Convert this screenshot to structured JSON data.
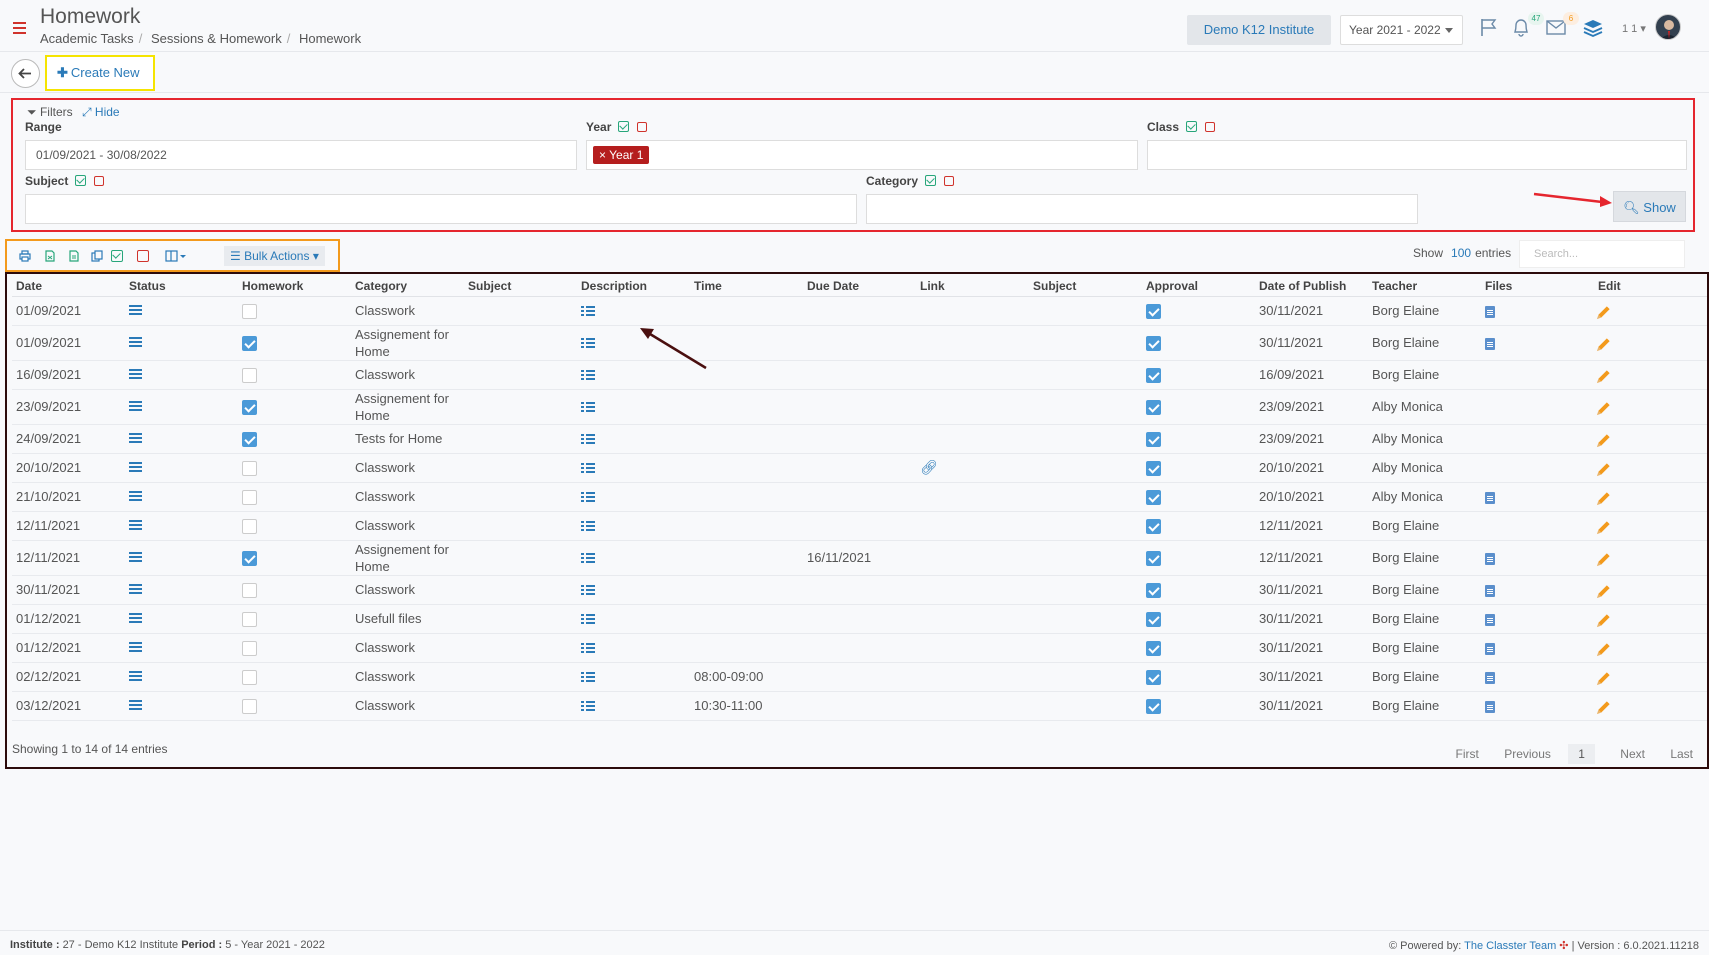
{
  "header": {
    "title": "Homework",
    "breadcrumb": [
      "Academic Tasks",
      "Sessions & Homework",
      "Homework"
    ],
    "institute_button": "Demo K12 Institute",
    "year_select": "Year 2021 - 2022",
    "notifications_count": "47",
    "messages_count": "6",
    "user_count": "1 1",
    "icons": [
      "menu-icon",
      "flag-icon",
      "bell-icon",
      "envelope-icon",
      "layers-icon",
      "avatar"
    ]
  },
  "actions": {
    "create_new": "Create New"
  },
  "filters": {
    "title": "Filters",
    "hide": "Hide",
    "range_label": "Range",
    "range_value": "01/09/2021 - 30/08/2022",
    "year_label": "Year",
    "year_tag": "Year 1",
    "class_label": "Class",
    "subject_label": "Subject",
    "category_label": "Category",
    "show_button": "Show"
  },
  "toolbar": {
    "bulk_actions": "Bulk Actions",
    "show_label": "Show",
    "entries_count": "100",
    "entries_label": "entries",
    "search_placeholder": "Search..."
  },
  "table": {
    "columns": [
      "Date",
      "Status",
      "Homework",
      "Category",
      "Subject",
      "Description",
      "Time",
      "Due Date",
      "Link",
      "Subject",
      "Approval",
      "Date of Publish",
      "Teacher",
      "Files",
      "Edit"
    ],
    "rows": [
      {
        "date": "01/09/2021",
        "homework": false,
        "category": "Classwork",
        "time": "",
        "due": "",
        "link": false,
        "publish": "30/11/2021",
        "teacher": "Borg Elaine",
        "file": true
      },
      {
        "date": "01/09/2021",
        "homework": true,
        "category": "Assignement for Home",
        "time": "",
        "due": "",
        "link": false,
        "publish": "30/11/2021",
        "teacher": "Borg Elaine",
        "file": true
      },
      {
        "date": "16/09/2021",
        "homework": false,
        "category": "Classwork",
        "time": "",
        "due": "",
        "link": false,
        "publish": "16/09/2021",
        "teacher": "Borg Elaine",
        "file": false
      },
      {
        "date": "23/09/2021",
        "homework": true,
        "category": "Assignement for Home",
        "time": "",
        "due": "",
        "link": false,
        "publish": "23/09/2021",
        "teacher": "Alby Monica",
        "file": false
      },
      {
        "date": "24/09/2021",
        "homework": true,
        "category": "Tests for Home",
        "time": "",
        "due": "",
        "link": false,
        "publish": "23/09/2021",
        "teacher": "Alby Monica",
        "file": false
      },
      {
        "date": "20/10/2021",
        "homework": false,
        "category": "Classwork",
        "time": "",
        "due": "",
        "link": true,
        "publish": "20/10/2021",
        "teacher": "Alby Monica",
        "file": false
      },
      {
        "date": "21/10/2021",
        "homework": false,
        "category": "Classwork",
        "time": "",
        "due": "",
        "link": false,
        "publish": "20/10/2021",
        "teacher": "Alby Monica",
        "file": true
      },
      {
        "date": "12/11/2021",
        "homework": false,
        "category": "Classwork",
        "time": "",
        "due": "",
        "link": false,
        "publish": "12/11/2021",
        "teacher": "Borg Elaine",
        "file": false
      },
      {
        "date": "12/11/2021",
        "homework": true,
        "category": "Assignement for Home",
        "time": "",
        "due": "16/11/2021",
        "link": false,
        "publish": "12/11/2021",
        "teacher": "Borg Elaine",
        "file": true
      },
      {
        "date": "30/11/2021",
        "homework": false,
        "category": "Classwork",
        "time": "",
        "due": "",
        "link": false,
        "publish": "30/11/2021",
        "teacher": "Borg Elaine",
        "file": true
      },
      {
        "date": "01/12/2021",
        "homework": false,
        "category": "Usefull files",
        "time": "",
        "due": "",
        "link": false,
        "publish": "30/11/2021",
        "teacher": "Borg Elaine",
        "file": true
      },
      {
        "date": "01/12/2021",
        "homework": false,
        "category": "Classwork",
        "time": "",
        "due": "",
        "link": false,
        "publish": "30/11/2021",
        "teacher": "Borg Elaine",
        "file": true
      },
      {
        "date": "02/12/2021",
        "homework": false,
        "category": "Classwork",
        "time": "08:00-09:00",
        "due": "",
        "link": false,
        "publish": "30/11/2021",
        "teacher": "Borg Elaine",
        "file": true
      },
      {
        "date": "03/12/2021",
        "homework": false,
        "category": "Classwork",
        "time": "10:30-11:00",
        "due": "",
        "link": false,
        "publish": "30/11/2021",
        "teacher": "Borg Elaine",
        "file": true
      }
    ],
    "showing": "Showing 1 to 14 of 14 entries",
    "pager": {
      "first": "First",
      "previous": "Previous",
      "current": "1",
      "next": "Next",
      "last": "Last"
    }
  },
  "footer": {
    "institute_label": "Institute :",
    "institute_value": "27 - Demo K12 Institute",
    "period_label": "Period :",
    "period_value": "5 - Year 2021 - 2022",
    "powered_by": "Powered by:",
    "team": "The Classter Team",
    "version": "| Version : 6.0.2021.11218"
  },
  "colors": {
    "accent": "#2a7ab8",
    "danger": "#d0332c",
    "success": "#27a67a",
    "warning": "#f39a1c"
  }
}
